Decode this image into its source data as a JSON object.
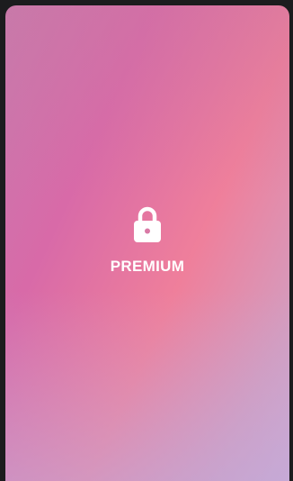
{
  "card": {
    "label": "PREMIUM",
    "icon": "lock-icon"
  },
  "colors": {
    "page_background": "#1c1c1e",
    "gradient_start": "#c87aae",
    "gradient_mid": "#ef7f9b",
    "gradient_end": "#cfa9d0",
    "text": "#ffffff"
  }
}
